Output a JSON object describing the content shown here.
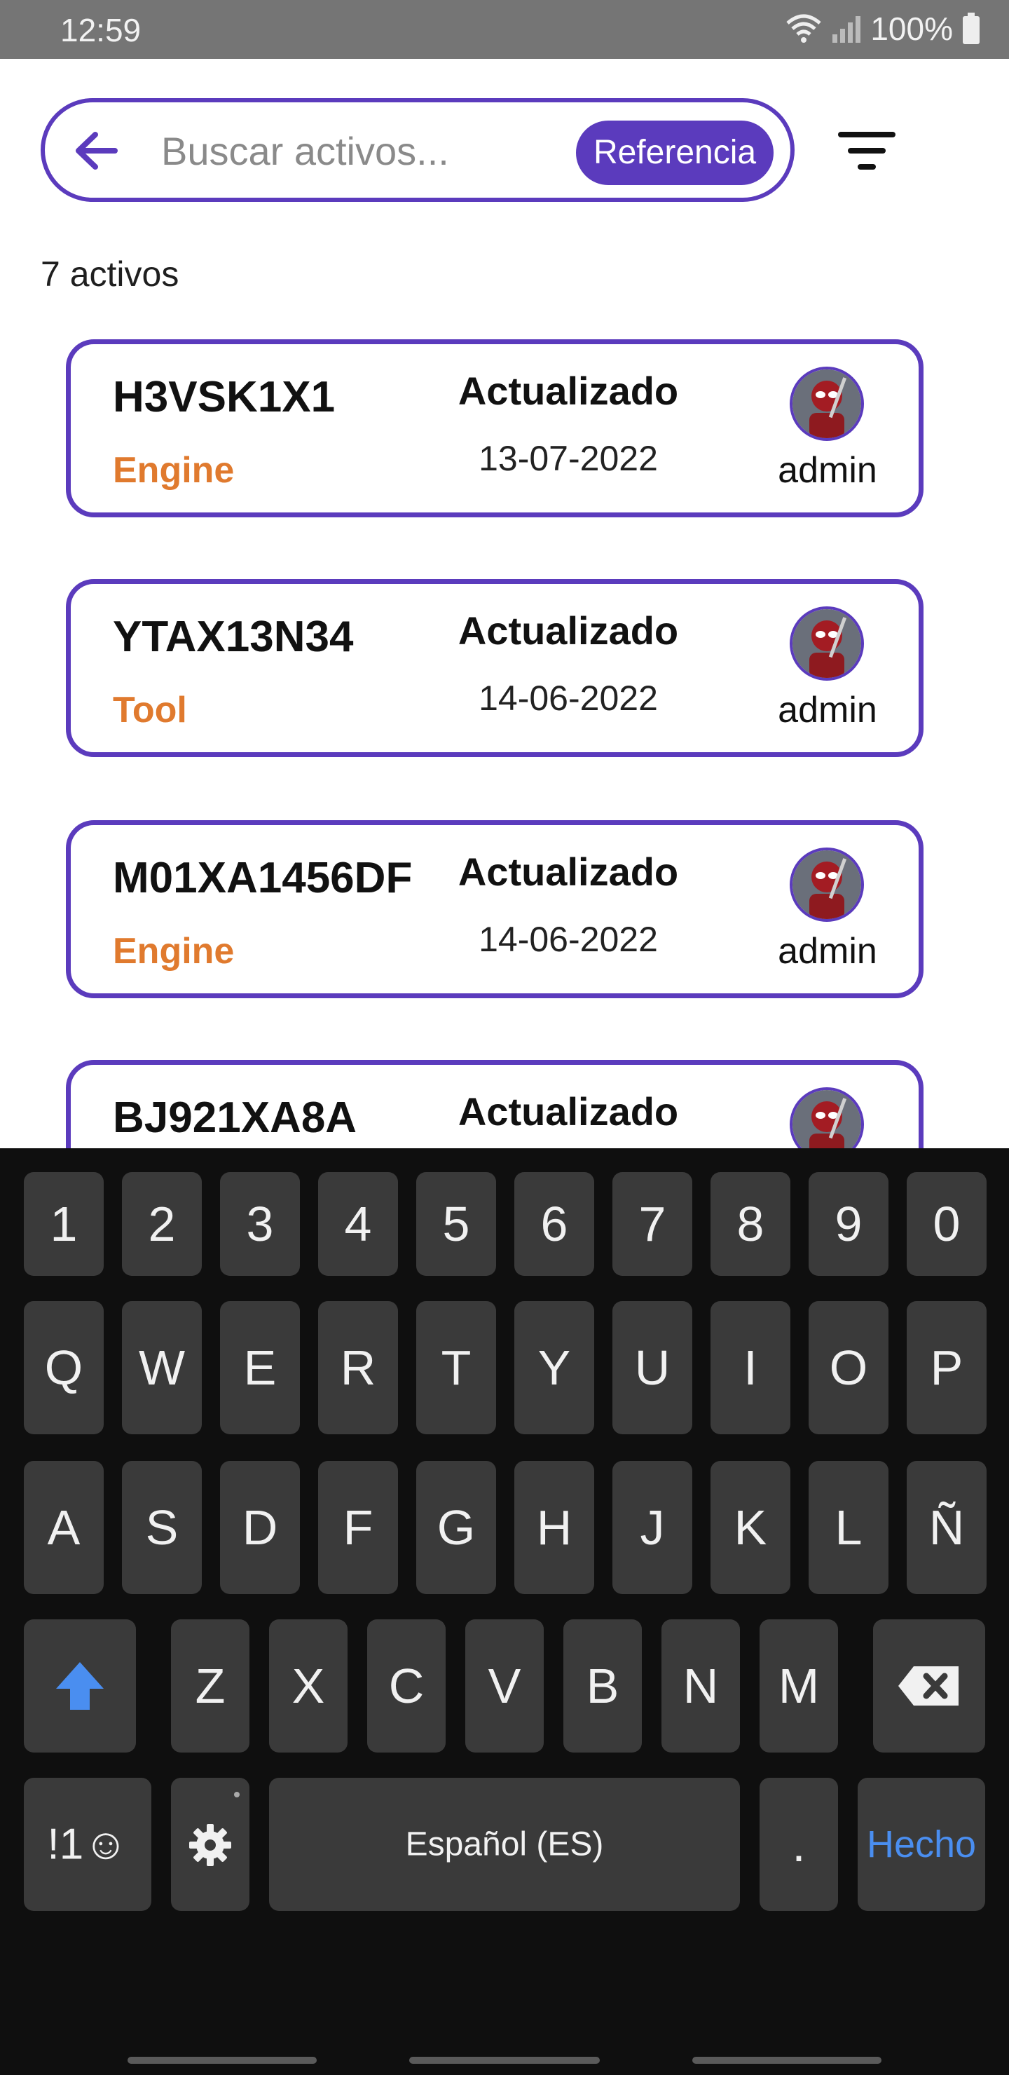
{
  "status_bar": {
    "time": "12:59",
    "battery": "100%",
    "icons": [
      "wifi-icon",
      "signal-icon",
      "battery-icon"
    ]
  },
  "search": {
    "placeholder": "Buscar activos...",
    "value": "",
    "chip_label": "Referencia",
    "back_icon": "arrow-left-icon",
    "filter_icon": "filter-icon"
  },
  "results": {
    "count_label": "7 activos"
  },
  "assets": [
    {
      "code": "H3VSK1X1",
      "type": "Engine",
      "updated_label": "Actualizado",
      "date": "13-07-2022",
      "user": "admin"
    },
    {
      "code": "YTAX13N34",
      "type": "Tool",
      "updated_label": "Actualizado",
      "date": "14-06-2022",
      "user": "admin"
    },
    {
      "code": "M01XA1456DF",
      "type": "Engine",
      "updated_label": "Actualizado",
      "date": "14-06-2022",
      "user": "admin"
    },
    {
      "code": "BJ921XA8A",
      "type": "",
      "updated_label": "Actualizado",
      "date": "",
      "user": ""
    }
  ],
  "keyboard": {
    "row_numbers": [
      "1",
      "2",
      "3",
      "4",
      "5",
      "6",
      "7",
      "8",
      "9",
      "0"
    ],
    "row_q": [
      "Q",
      "W",
      "E",
      "R",
      "T",
      "Y",
      "U",
      "I",
      "O",
      "P"
    ],
    "row_a": [
      "A",
      "S",
      "D",
      "F",
      "G",
      "H",
      "J",
      "K",
      "L",
      "Ñ"
    ],
    "row_z": [
      "Z",
      "X",
      "C",
      "V",
      "B",
      "N",
      "M"
    ],
    "symbols_label": "!1☺",
    "space_label": "Español (ES)",
    "period_label": ".",
    "done_label": "Hecho"
  },
  "colors": {
    "accent": "#5b3bbd",
    "type_text": "#e07a2e",
    "keyboard_bg": "#0f0f0f",
    "key_bg": "#3a3a3a",
    "keyboard_accent": "#4a8ef0"
  }
}
